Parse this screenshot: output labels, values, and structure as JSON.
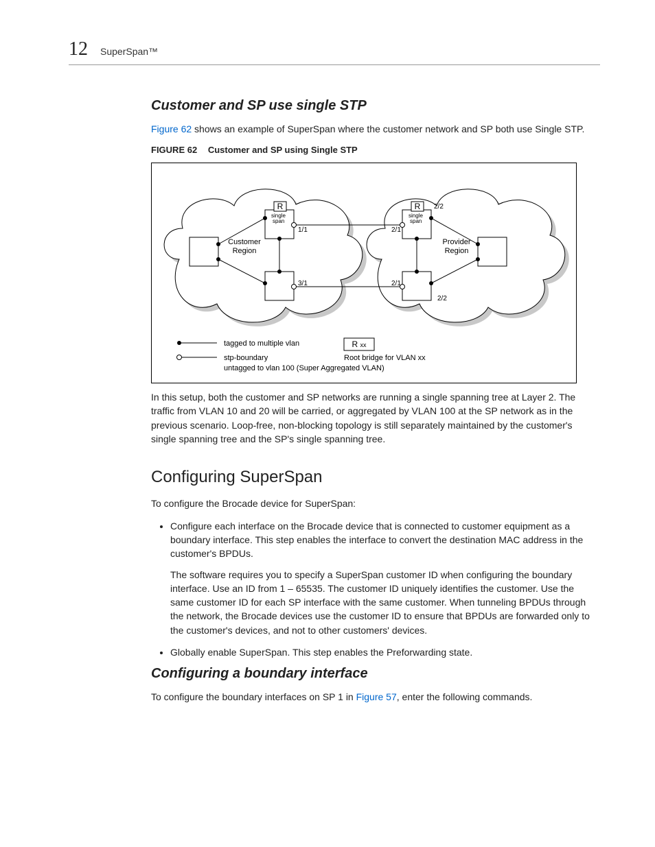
{
  "header": {
    "chapter_number": "12",
    "running_title": "SuperSpan™"
  },
  "section1": {
    "title": "Customer and SP use single STP",
    "intro_link": "Figure 62",
    "intro_rest": " shows an example of SuperSpan where the customer network and SP both use Single STP.",
    "figure_label": "FIGURE 62",
    "figure_title": "Customer and SP using Single STP",
    "figure": {
      "r_left": "R",
      "r_right": "R",
      "single_span_left": "single\nspan",
      "single_span_right": "single\nspan",
      "port_1_1": "1/1",
      "port_2_1_top": "2/1",
      "port_2_2_top": "2/2",
      "port_3_1": "3/1",
      "port_2_1_bottom": "2/1",
      "port_2_2_bottom": "2/2",
      "customer_region": "Customer\nRegion",
      "provider_region": "Provider\nRegion",
      "legend_tagged": "tagged to multiple vlan",
      "legend_stp": "stp-boundary",
      "legend_untagged": "untagged to vlan 100 (Super Aggregated VLAN)",
      "r_xx": "R xx",
      "root_bridge": "Root bridge for VLAN xx"
    },
    "post_figure": "In this setup, both the customer and SP networks are running a single spanning tree at Layer 2. The traffic from VLAN 10 and 20 will be carried, or aggregated by VLAN 100 at the SP network as in the previous scenario. Loop-free, non-blocking topology is still separately maintained by the customer's single spanning tree and the SP's single spanning tree."
  },
  "section2": {
    "title": "Configuring SuperSpan",
    "intro": "To configure the Brocade device for SuperSpan:",
    "bullet1": "Configure each interface on the Brocade device that is connected to customer equipment as a boundary interface. This step enables the interface to convert the destination MAC address in the customer's BPDUs.",
    "bullet1_cont": "The software requires you to specify a SuperSpan customer ID when configuring the boundary interface. Use an ID from 1 – 65535. The customer ID uniquely identifies the customer. Use the same customer ID for each SP interface with the same customer. When tunneling BPDUs through the network, the Brocade devices use the customer ID to ensure that BPDUs are forwarded only to the customer's devices, and not to other customers' devices.",
    "bullet2": "Globally enable SuperSpan. This step enables the Preforwarding state."
  },
  "section3": {
    "title": "Configuring a boundary interface",
    "intro_before": "To configure the boundary interfaces on SP 1 in ",
    "intro_link": "Figure 57",
    "intro_after": ", enter the following commands."
  }
}
